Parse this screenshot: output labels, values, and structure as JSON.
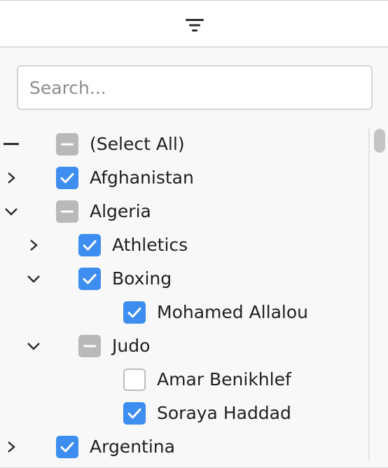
{
  "header": {
    "icon": "filter-lines-icon"
  },
  "search": {
    "placeholder": "Search..."
  },
  "tree": {
    "select_all": {
      "label": "(Select All)",
      "state": "indeterminate",
      "expander": "minus"
    },
    "afghanistan": {
      "label": "Afghanistan",
      "state": "checked",
      "expander": "collapsed"
    },
    "algeria": {
      "label": "Algeria",
      "state": "indeterminate",
      "expander": "expanded"
    },
    "athletics": {
      "label": "Athletics",
      "state": "checked",
      "expander": "collapsed"
    },
    "boxing": {
      "label": "Boxing",
      "state": "checked",
      "expander": "expanded"
    },
    "mohamed_allalou": {
      "label": "Mohamed Allalou",
      "state": "checked"
    },
    "judo": {
      "label": "Judo",
      "state": "indeterminate",
      "expander": "expanded"
    },
    "amar_benikhlef": {
      "label": "Amar Benikhlef",
      "state": "unchecked"
    },
    "soraya_haddad": {
      "label": "Soraya Haddad",
      "state": "checked"
    },
    "argentina": {
      "label": "Argentina",
      "state": "checked",
      "expander": "collapsed"
    }
  },
  "colors": {
    "checked": "#3d8ef0",
    "indeterminate": "#b9b9b9",
    "text": "#1f1f1f"
  }
}
